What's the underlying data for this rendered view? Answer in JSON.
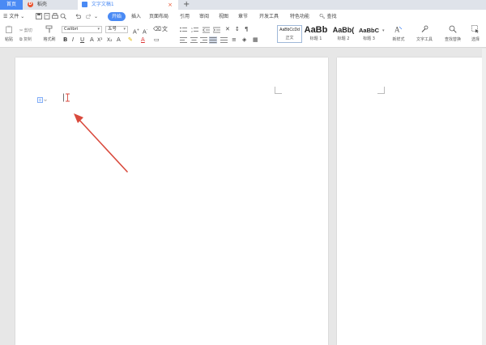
{
  "tabs": {
    "home": "首页",
    "daoke": "稻壳",
    "doc": "文字文稿1",
    "close": "×",
    "add": "+"
  },
  "menu": {
    "file": "文件",
    "items": [
      "开始",
      "插入",
      "页面布局",
      "引用",
      "审阅",
      "视图",
      "章节",
      "开发工具",
      "特色功能"
    ],
    "search": "查找"
  },
  "ribbon": {
    "paste": "粘贴",
    "cut": "剪切",
    "copy": "复制",
    "format_painter": "格式刷",
    "font": "Calibri",
    "size": "五号",
    "styles": [
      {
        "preview": "AaBbCcDd",
        "label": "正文"
      },
      {
        "preview": "AaBb",
        "label": "标题 1"
      },
      {
        "preview": "AaBb(",
        "label": "标题 2"
      },
      {
        "preview": "AaBbC",
        "label": "标题 3"
      }
    ],
    "new_style": "新样式",
    "text_tools": "文字工具",
    "find_replace": "查找替换",
    "select": "选择"
  },
  "colors": {
    "accent": "#4a8af4",
    "arrow": "#d94a3d"
  }
}
